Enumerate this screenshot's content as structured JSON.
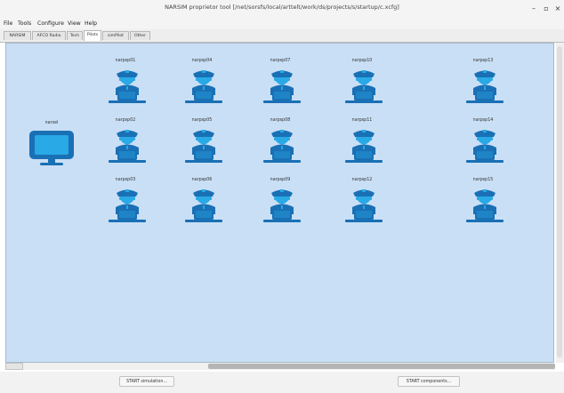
{
  "window": {
    "title": "NARSIM proprietor tool [/net/sorsfs/local/arttelt/work/ds/projects/s/startup/c.xcfg]",
    "minimize_glyph": "–",
    "maximize_glyph": "▫",
    "close_glyph": "×"
  },
  "menu": [
    "File",
    "Tools",
    "Configure",
    "View",
    "Help"
  ],
  "tabs": [
    {
      "label": "NARSIM",
      "active": false
    },
    {
      "label": "AFCO Radio",
      "active": false
    },
    {
      "label": "Tech",
      "active": false
    },
    {
      "label": "Pilots",
      "active": true
    },
    {
      "label": "simPilot",
      "active": false
    },
    {
      "label": "Other",
      "active": false
    }
  ],
  "canvas": {
    "background": "#c9dff5",
    "icon_color": "#1a70b5",
    "accent_color": "#29a9e6",
    "monitor_node": {
      "label": "narsel",
      "icon": "monitor-icon"
    },
    "pilot_icon": "pilot-workstation-icon",
    "pilots": [
      "narpsp01",
      "narpsp04",
      "narpsp07",
      "narpsp10",
      "narpsp13",
      "narpsp02",
      "narpsp05",
      "narpsp08",
      "narpsp11",
      "narpsp14",
      "narpsp03",
      "narpsp06",
      "narpsp09",
      "narpsp12",
      "narpsp15"
    ]
  },
  "footer": {
    "start_simulation": "START simulation...",
    "start_components": "START components..."
  }
}
